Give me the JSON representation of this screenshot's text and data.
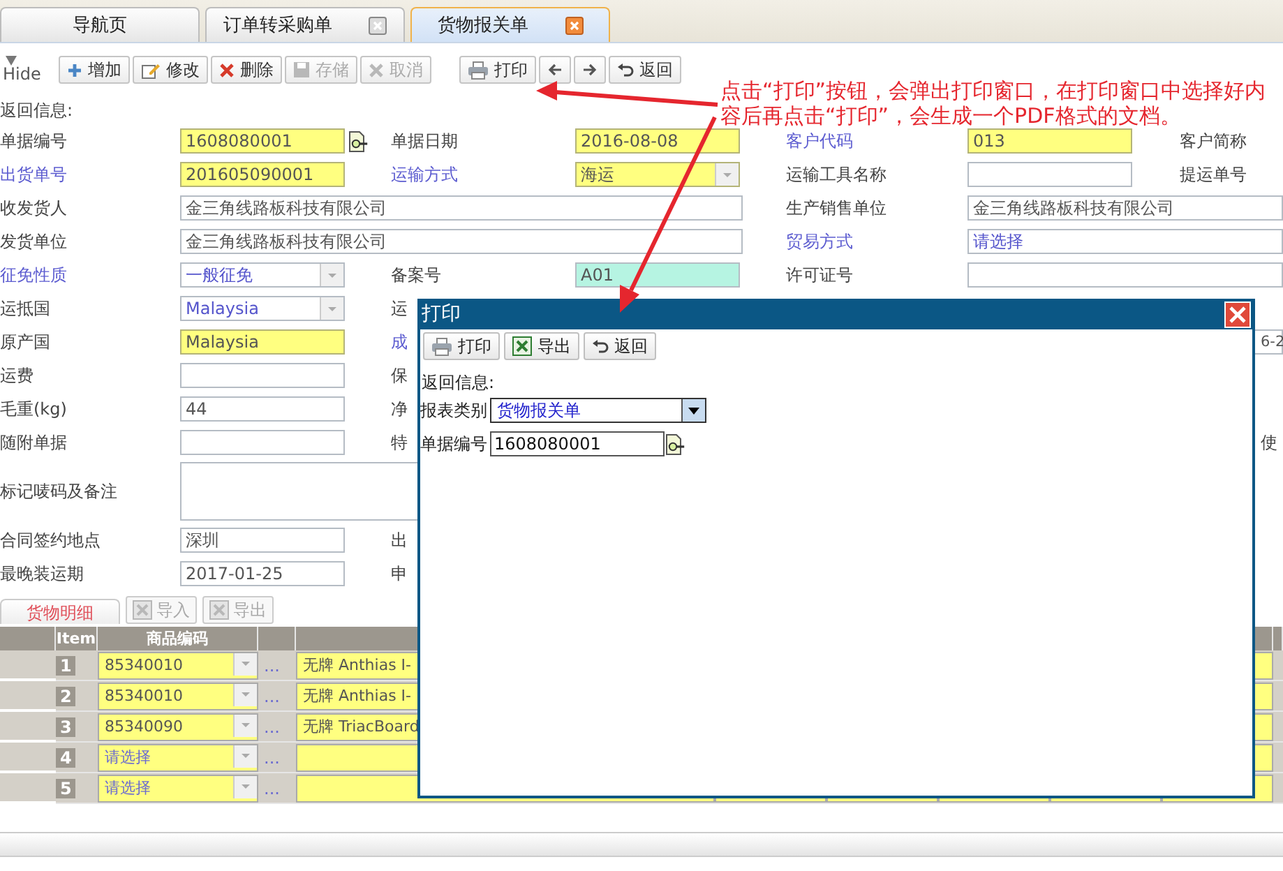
{
  "tabs": [
    {
      "label": "导航页",
      "closable": false,
      "selected": false
    },
    {
      "label": "订单转采购单",
      "closable": true,
      "selected": false
    },
    {
      "label": "货物报关单",
      "closable": true,
      "selected": true
    }
  ],
  "toolbar": {
    "toggle": "Hide",
    "buttons": [
      {
        "kind": "add",
        "label": "增加",
        "disabled": false
      },
      {
        "kind": "edit",
        "label": "修改",
        "disabled": false
      },
      {
        "kind": "delete",
        "label": "删除",
        "disabled": false
      },
      {
        "kind": "save",
        "label": "存储",
        "disabled": true
      },
      {
        "kind": "cancel",
        "label": "取消",
        "disabled": true
      },
      {
        "kind": "print",
        "label": "打印",
        "disabled": false
      },
      {
        "kind": "prev",
        "disabled": false
      },
      {
        "kind": "next",
        "disabled": false
      },
      {
        "kind": "return",
        "label": "返回",
        "disabled": false
      }
    ]
  },
  "return_info_label": "返回信息:",
  "form": {
    "rows": [
      {
        "cells": [
          {
            "kind": "label",
            "text": "单据编号",
            "link": false
          },
          {
            "kind": "lookup-field",
            "value": "1608080001",
            "required": true,
            "locked": false
          },
          {
            "kind": "label",
            "text": "单据日期",
            "link": false
          },
          {
            "kind": "field",
            "value": "2016-08-08",
            "required": true,
            "locked": false
          },
          {
            "kind": "label",
            "text": "客户代码",
            "link": true
          },
          {
            "kind": "field",
            "value": "013",
            "required": true,
            "locked": false
          },
          {
            "kind": "label",
            "text": "客户简称",
            "link": false
          }
        ]
      },
      {
        "cells": [
          {
            "kind": "label",
            "text": "出货单号",
            "link": true
          },
          {
            "kind": "field",
            "value": "201605090001",
            "required": true,
            "locked": false
          },
          {
            "kind": "label",
            "text": "运输方式",
            "link": true
          },
          {
            "kind": "select",
            "value": "海运",
            "required": true,
            "locked": false
          },
          {
            "kind": "label",
            "text": "运输工具名称",
            "link": false
          },
          {
            "kind": "field",
            "required": false,
            "locked": false
          },
          {
            "kind": "label",
            "text": "提运单号",
            "link": false
          }
        ]
      },
      {
        "cells": [
          {
            "kind": "label",
            "text": "收发货人",
            "link": false
          },
          {
            "kind": "wide-field",
            "value": "金三角线路板科技有限公司",
            "required": false,
            "locked": false
          },
          {
            "kind": "label",
            "text": "生产销售单位",
            "link": false
          },
          {
            "kind": "wide-field",
            "value": "金三角线路板科技有限公司",
            "required": false,
            "locked": false
          }
        ]
      },
      {
        "cells": [
          {
            "kind": "label",
            "text": "发货单位",
            "link": false
          },
          {
            "kind": "wide-field",
            "value": "金三角线路板科技有限公司",
            "required": false,
            "locked": false
          },
          {
            "kind": "label",
            "text": "贸易方式",
            "link": true
          },
          {
            "kind": "wide-select",
            "value": "请选择",
            "required": false,
            "locked": false
          }
        ]
      },
      {
        "cells": [
          {
            "kind": "label",
            "text": "征免性质",
            "link": true
          },
          {
            "kind": "select",
            "value": "一般征免",
            "required": false,
            "locked": false
          },
          {
            "kind": "label",
            "text": "备案号",
            "link": false
          },
          {
            "kind": "field",
            "value": "A01",
            "required": false,
            "locked": true
          },
          {
            "kind": "label",
            "text": "许可证号",
            "link": false
          },
          {
            "kind": "wide-field",
            "required": false,
            "locked": false
          }
        ]
      },
      {
        "cells": [
          {
            "kind": "label",
            "text": "运抵国",
            "link": false
          },
          {
            "kind": "select",
            "value": "Malaysia",
            "required": false,
            "locked": false
          },
          {
            "kind": "label",
            "text": "运",
            "link": false
          }
        ]
      },
      {
        "cells": [
          {
            "kind": "label",
            "text": "原产国",
            "link": false
          },
          {
            "kind": "field",
            "value": "Malaysia",
            "required": true,
            "locked": false
          },
          {
            "kind": "label",
            "text": "成",
            "link": true
          },
          {
            "kind": "edge-field",
            "value": "6-2",
            "required": false,
            "locked": false
          }
        ]
      },
      {
        "cells": [
          {
            "kind": "label",
            "text": "运费",
            "link": false
          },
          {
            "kind": "field",
            "required": false,
            "locked": false
          },
          {
            "kind": "label",
            "text": "保",
            "link": false
          }
        ]
      },
      {
        "cells": [
          {
            "kind": "label",
            "text": "毛重(kg)",
            "link": false
          },
          {
            "kind": "field",
            "value": "44",
            "required": false,
            "locked": false
          },
          {
            "kind": "label",
            "text": "净",
            "link": false
          }
        ]
      },
      {
        "cells": [
          {
            "kind": "label",
            "text": "随附单据",
            "link": false
          },
          {
            "kind": "field",
            "required": false,
            "locked": false
          },
          {
            "kind": "label",
            "text": "特",
            "link": false
          },
          {
            "kind": "edge-label",
            "text": "使"
          }
        ]
      },
      {
        "cells": [
          {
            "kind": "label",
            "text": "标记唛码及备注",
            "link": false
          },
          {
            "kind": "textarea",
            "required": false,
            "locked": false
          }
        ]
      },
      {
        "cells": [
          {
            "kind": "label",
            "text": "合同签约地点",
            "link": false
          },
          {
            "kind": "field",
            "value": "深圳",
            "required": false,
            "locked": false
          },
          {
            "kind": "label",
            "text": "出",
            "link": false
          }
        ]
      },
      {
        "cells": [
          {
            "kind": "label",
            "text": "最晚装运期",
            "link": false
          },
          {
            "kind": "field",
            "value": "2017-01-25",
            "required": false,
            "locked": false
          },
          {
            "kind": "label",
            "text": "申",
            "link": false
          }
        ]
      }
    ]
  },
  "goods": {
    "tab": "货物明细",
    "buttons": [
      {
        "label": "导入",
        "disabled": true
      },
      {
        "label": "导出",
        "disabled": true
      }
    ],
    "columns": [
      "Item",
      "商品编码"
    ],
    "rows": [
      {
        "item": "1",
        "code": "85340010",
        "chosen": true,
        "more": "...",
        "description": "无牌 Anthias I-"
      },
      {
        "item": "2",
        "code": "85340010",
        "chosen": true,
        "more": "...",
        "description": "无牌 Anthias I-"
      },
      {
        "item": "3",
        "code": "85340090",
        "chosen": true,
        "more": "...",
        "description": "无牌 TriacBoard"
      },
      {
        "item": "4",
        "code": "请选择",
        "chosen": false,
        "more": "..."
      },
      {
        "item": "5",
        "code": "请选择",
        "chosen": false,
        "more": "..."
      }
    ]
  },
  "print_dialog": {
    "title": "打印",
    "buttons": [
      {
        "kind": "print",
        "label": "打印"
      },
      {
        "kind": "export",
        "label": "导出"
      },
      {
        "kind": "return",
        "label": "返回"
      }
    ],
    "return_info_label": "返回信息:",
    "fields": [
      {
        "kind": "select",
        "label": "报表类别",
        "value": "货物报关单"
      },
      {
        "kind": "lookup-field",
        "label": "单据编号",
        "value": "1608080001"
      }
    ]
  },
  "annotation": {
    "text": "点击“打印”按钮，会弹出打印窗口，在打印窗口中选择好内容后再点击“打印”，会生成一个PDF格式的文档。"
  }
}
